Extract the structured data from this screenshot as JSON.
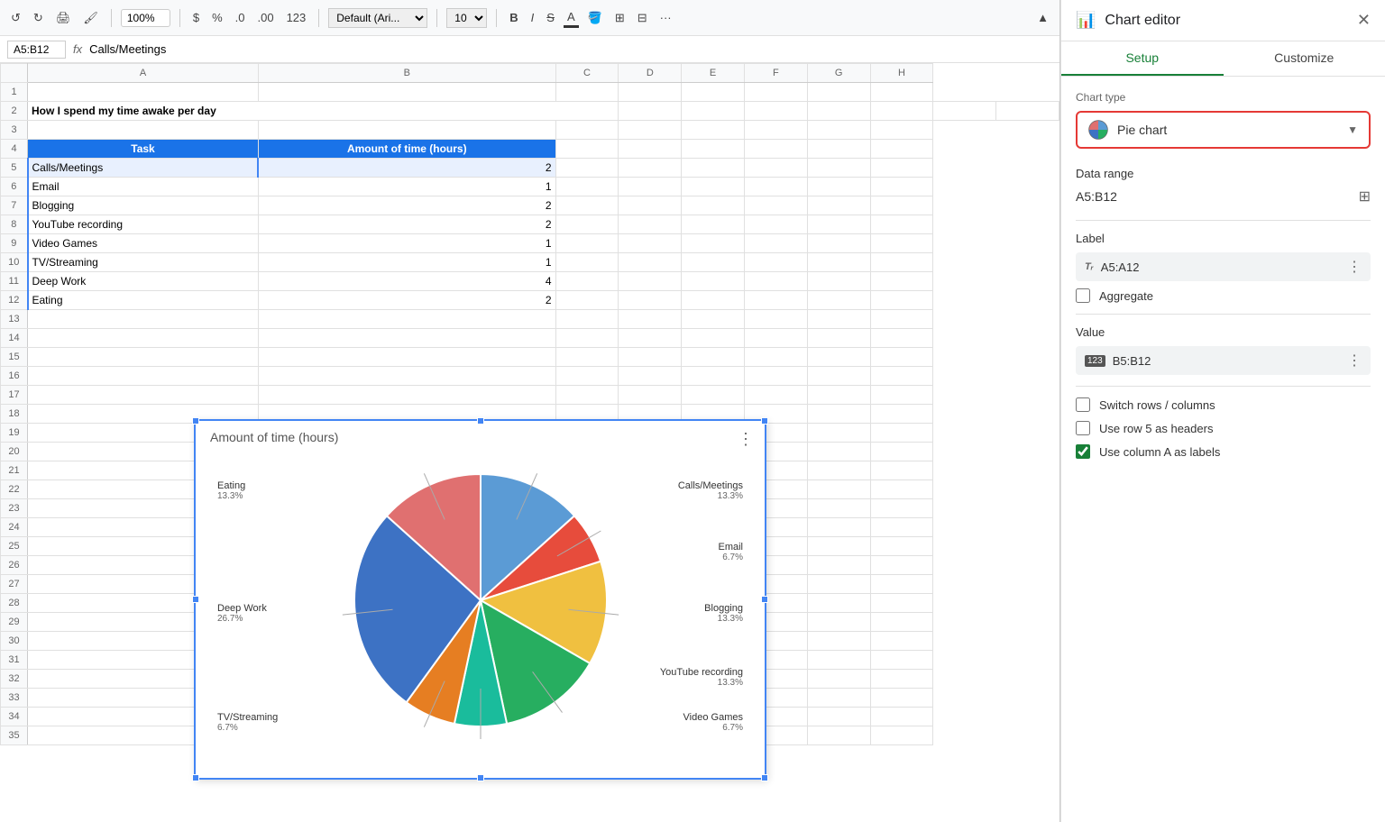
{
  "toolbar": {
    "zoom": "100%",
    "currency": "$",
    "percent": "%",
    "decimal0": ".0",
    "decimal00": ".00",
    "format": "123",
    "font": "Default (Ari...",
    "size": "10",
    "bold": "B",
    "italic": "I",
    "strikethrough": "S",
    "more": "···"
  },
  "formulaBar": {
    "cellRef": "A5:B12",
    "formula": "Calls/Meetings"
  },
  "columns": [
    "A",
    "B",
    "C",
    "D",
    "E",
    "F",
    "G",
    "H"
  ],
  "rows": [
    1,
    2,
    3,
    4,
    5,
    6,
    7,
    8,
    9,
    10,
    11,
    12,
    13,
    14,
    15,
    16,
    17,
    18,
    19,
    20,
    21,
    22,
    23,
    24,
    25,
    26,
    27,
    28,
    29,
    30,
    31,
    32,
    33,
    34,
    35
  ],
  "spreadsheet": {
    "title": "How I spend my time awake per day",
    "headers": [
      "Task",
      "Amount of time (hours)"
    ],
    "data": [
      [
        "Calls/Meetings",
        "2"
      ],
      [
        "Email",
        "1"
      ],
      [
        "Blogging",
        "2"
      ],
      [
        "YouTube recording",
        "2"
      ],
      [
        "Video Games",
        "1"
      ],
      [
        "TV/Streaming",
        "1"
      ],
      [
        "Deep Work",
        "4"
      ],
      [
        "Eating",
        "2"
      ]
    ]
  },
  "chart": {
    "title": "Amount of time (hours)",
    "segments": [
      {
        "label": "Calls/Meetings",
        "percent": "13.3%",
        "value": 2,
        "color": "#5b9bd5",
        "angle": 48
      },
      {
        "label": "Email",
        "percent": "6.7%",
        "value": 1,
        "color": "#e74c3c",
        "angle": 24
      },
      {
        "label": "Blogging",
        "percent": "13.3%",
        "value": 2,
        "color": "#f0c040",
        "angle": 48
      },
      {
        "label": "YouTube recording",
        "percent": "13.3%",
        "value": 2,
        "color": "#27ae60",
        "angle": 48
      },
      {
        "label": "Video Games",
        "percent": "6.7%",
        "value": 1,
        "color": "#1abc9c",
        "angle": 24
      },
      {
        "label": "TV/Streaming",
        "percent": "6.7%",
        "value": 1,
        "color": "#e67e22",
        "angle": 24
      },
      {
        "label": "Deep Work",
        "percent": "26.7%",
        "value": 4,
        "color": "#3d72c4",
        "angle": 96
      },
      {
        "label": "Eating",
        "percent": "13.3%",
        "value": 2,
        "color": "#e07070",
        "angle": 48
      }
    ]
  },
  "editor": {
    "title": "Chart editor",
    "tabs": [
      "Setup",
      "Customize"
    ],
    "activeTab": "Setup",
    "chartTypeLabel": "Chart type",
    "chartTypeValue": "Pie chart",
    "dataRangeLabel": "Data range",
    "dataRangeValue": "A5:B12",
    "labelSectionLabel": "Label",
    "labelValue": "A5:A12",
    "aggregateLabel": "Aggregate",
    "valueSectionLabel": "Value",
    "valueFieldValue": "B5:B12",
    "switchRowsCols": "Switch rows / columns",
    "useRow5": "Use row 5 as headers",
    "useColA": "Use column A as labels"
  }
}
